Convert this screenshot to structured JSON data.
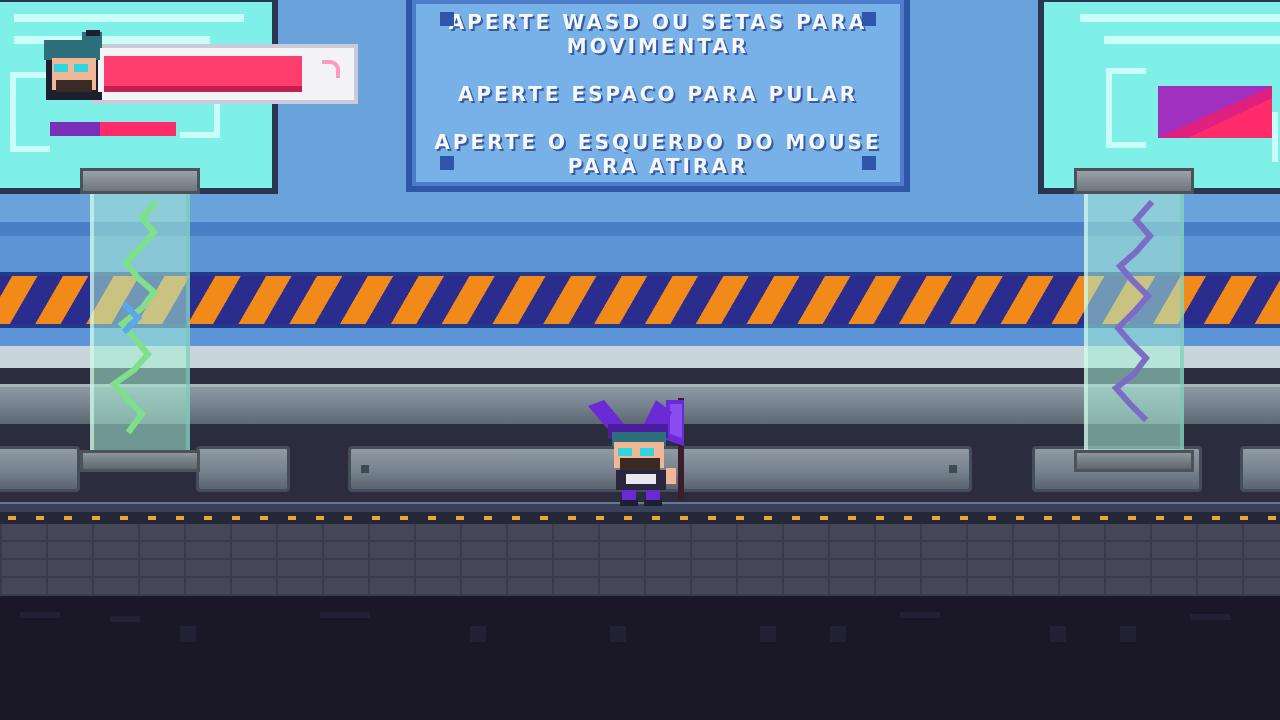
{
  "game": {
    "instructions": [
      "APERTE WASD OU SETAS PARA",
      "MOVIMENTAR",
      "APERTE ESPACO PARA PULAR",
      "APERTE O ESQUERDO DO MOUSE",
      "PARA ATIRAR"
    ]
  },
  "hud": {
    "health": 0.82,
    "energy": 0.4,
    "portrait_icon": "player-portrait-icon"
  },
  "player": {
    "icon": "wizard-player-icon",
    "weapon": "purple-flag-staff"
  },
  "colors": {
    "health": "#ff3d6e",
    "energy_track": "#7a2fb8",
    "energy_fill": "#ff2b6b",
    "hazard_orange": "#f28a1a",
    "hazard_blue": "#2b2d8e",
    "screen": "#7ff0e8"
  }
}
